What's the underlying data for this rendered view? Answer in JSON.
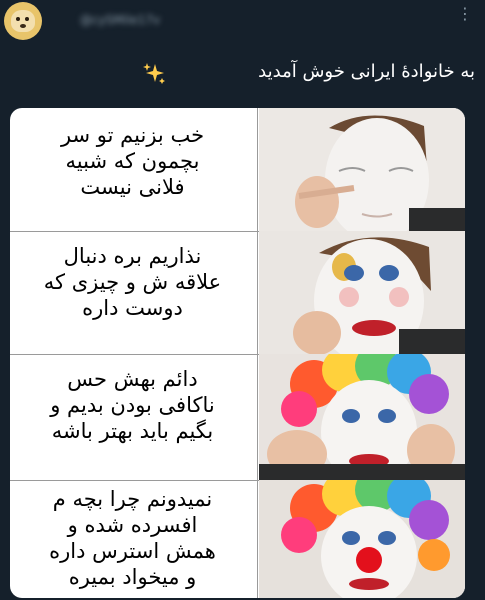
{
  "tweet": {
    "handle": "@cySMile17v",
    "text": "به خانوادهٔ ایرانی خوش آمدید",
    "more_icon": "more-icon"
  },
  "meme": {
    "panels": [
      {
        "lines": [
          "خب بزنیم تو سر",
          "بچمون که شبیه",
          "فلانی نیست"
        ]
      },
      {
        "lines": [
          "نذاریم بره دنبال",
          "علاقه ش و چیزی که",
          "دوست داره"
        ]
      },
      {
        "lines": [
          "دائم بهش حس",
          "ناکافی بودن بدیم و",
          "بگیم باید بهتر باشه"
        ]
      },
      {
        "lines": [
          "نمیدونم چرا بچه م",
          "افسرده شده و",
          "همش استرس داره",
          "و میخواد بمیره"
        ]
      }
    ]
  },
  "colors": {
    "background": "#15202b",
    "text": "#ffffff",
    "muted": "#8899a6",
    "sparkle": "#ffcc4d"
  }
}
